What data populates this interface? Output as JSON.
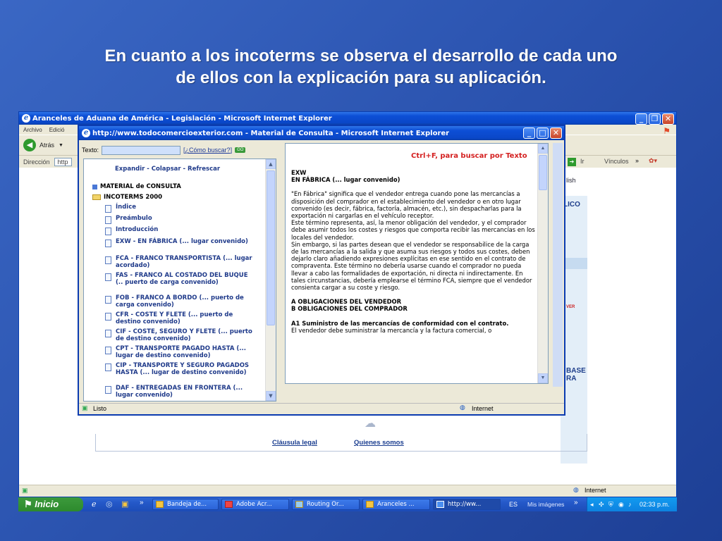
{
  "slide": {
    "title_line1": "En cuanto a los incoterms se observa el desarrollo de cada uno",
    "title_line2": "de ellos con la explicación para su aplicación."
  },
  "back_window": {
    "title": "Aranceles de Aduana de América - Legislación - Microsoft Internet Explorer",
    "menu": [
      "Archivo",
      "Edició"
    ],
    "back_label": "Atrás",
    "address_label": "Dirección",
    "address_value": "http",
    "go_label": "Ir",
    "links_label": "Vínculos",
    "side_text_1": "lish",
    "side_text_2": "LICO",
    "side_text_3": "BASE",
    "side_text_4": "RA",
    "side_logo": "VER",
    "footer_links": [
      "Cláusula legal",
      "Quienes somos"
    ],
    "status_zone": "Internet"
  },
  "front_window": {
    "title": "http://www.todocomercioexterior.com - Material de Consulta - Microsoft Internet Explorer",
    "search_label": "Texto:",
    "search_value": "",
    "help_link": "¿Cómo buscar?",
    "go_button": "GO",
    "tree_controls": "Expandir - Colapsar - Refrescar",
    "tree_root": "MATERIAL de CONSULTA",
    "tree_folder": "INCOTERMS 2000",
    "tree_items": [
      "Índice",
      "Preámbulo",
      "Introducción",
      "EXW - EN FÁBRICA (... lugar convenido)",
      "FCA - FRANCO TRANSPORTISTA (... lugar acordado)",
      "FAS - FRANCO AL COSTADO DEL BUQUE (.. puerto de carga convenido)",
      "FOB - FRANCO A BORDO (... puerto de carga convenido)",
      "CFR - COSTE Y FLETE (... puerto de destino convenido)",
      "CIF - COSTE, SEGURO Y FLETE (... puerto de destino convenido)",
      "CPT - TRANSPORTE PAGADO HASTA (... lugar de destino convenido)",
      "CIP - TRANSPORTE Y SEGURO PAGADOS HASTA (... lugar de destino convenido)",
      "DAF - ENTREGADAS EN FRONTERA (... lugar convenido)"
    ],
    "find_hint": "Ctrl+F, para buscar por Texto",
    "doc_heading1": "EXW",
    "doc_heading2": "EN FÁBRICA (... lugar convenido)",
    "doc_para1": "\"En Fábrica\" significa que el vendedor entrega cuando pone las mercancías a disposición del comprador en el establecimiento del vendedor o en otro lugar convenido (es decir, fábrica, factoría, almacén, etc.), sin despacharlas para la exportación ni cargarlas en el vehículo receptor.",
    "doc_para2": "Este término representa, así, la menor obligación del vendedor, y el comprador debe asumir todos los costes y riesgos que comporta recibir las mercancías en los locales del vendedor.",
    "doc_para3": "Sin embargo, si las partes desean que el vendedor se responsabilice de la carga de las mercancías a la salida y que asuma sus riesgos y todos sus costes, deben dejarlo claro añadiendo expresiones explícitas en ese sentido en el contrato de compraventa. Este término no debería usarse cuando el comprador no pueda llevar a cabo las formalidades de exportación, ni directa ni indirectamente. En tales circunstancias, debería emplearse el término FCA, siempre que el vendedor consienta cargar a su coste y riesgo.",
    "doc_obl_a": "A OBLIGACIONES DEL VENDEDOR",
    "doc_obl_b": "B OBLIGACIONES DEL COMPRADOR",
    "doc_a1": "A1 Suministro de las mercancías de conformidad con el contrato.",
    "doc_a1_text": "El vendedor debe suministrar la mercancía y la factura comercial, o",
    "status_left": "Listo",
    "status_zone": "Internet"
  },
  "taskbar": {
    "start": "Inicio",
    "tasks": [
      "Bandeja de...",
      "Adobe Acr...",
      "Routing Or...",
      "Aranceles ...",
      "http://ww..."
    ],
    "lang": "ES",
    "my_images": "Mis imágenes",
    "clock": "02:33 p.m."
  },
  "colors": {
    "slide_bg": "#2a52ae",
    "xp_title": "#0a47c8",
    "link_blue": "#1f3a8a",
    "find_hint_red": "#d42020"
  }
}
